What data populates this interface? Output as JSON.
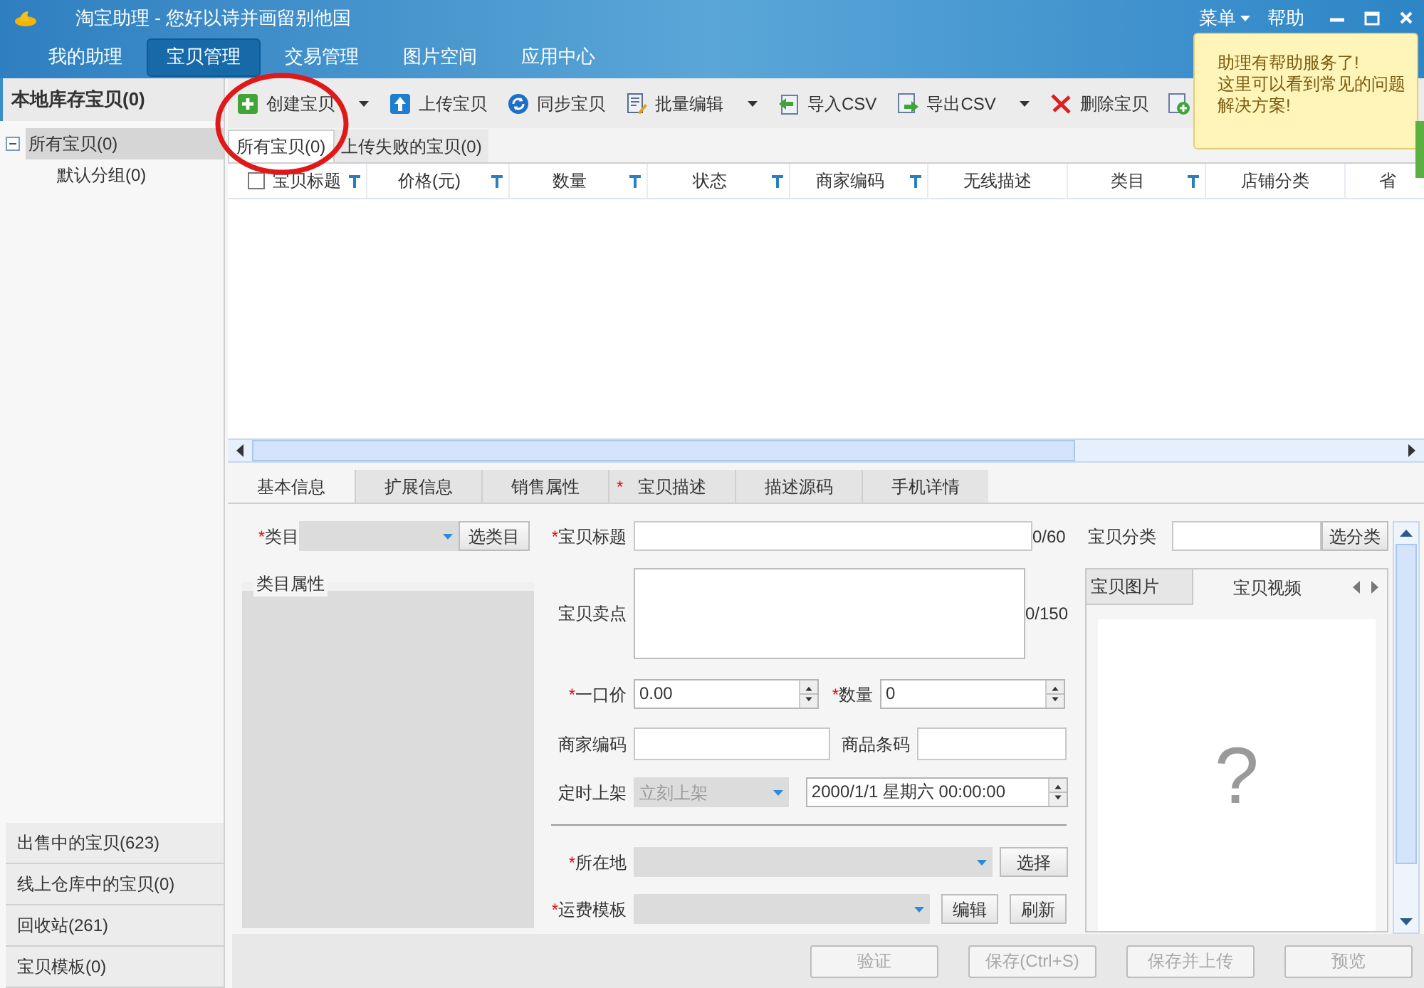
{
  "window": {
    "title": "淘宝助理 - 您好以诗并画留别他国",
    "menu": "菜单",
    "help": "帮助"
  },
  "nav_tabs": [
    {
      "label": "我的助理",
      "selected": false
    },
    {
      "label": "宝贝管理",
      "selected": true
    },
    {
      "label": "交易管理",
      "selected": false
    },
    {
      "label": "图片空间",
      "selected": false
    },
    {
      "label": "应用中心",
      "selected": false
    }
  ],
  "help_tooltip": {
    "lines": [
      "助理有帮助服务了!",
      "这里可以看到常见的问题",
      "解决方案!"
    ]
  },
  "sidebar": {
    "header": "本地库存宝贝(0)",
    "tree": [
      {
        "label": "所有宝贝(0)",
        "selected": true,
        "expanded": true,
        "children": [
          {
            "label": "默认分组(0)",
            "selected": false
          }
        ]
      }
    ],
    "bottom_items": [
      "出售中的宝贝(623)",
      "线上仓库中的宝贝(0)",
      "回收站(261)",
      "宝贝模板(0)"
    ]
  },
  "toolbar": [
    {
      "kind": "add",
      "label": "创建宝贝",
      "dropdown": true
    },
    {
      "kind": "upload",
      "label": "上传宝贝",
      "dropdown": false
    },
    {
      "kind": "sync",
      "label": "同步宝贝",
      "dropdown": false
    },
    {
      "kind": "edit",
      "label": "批量编辑",
      "dropdown": true
    },
    {
      "kind": "import",
      "label": "导入CSV",
      "dropdown": false
    },
    {
      "kind": "export",
      "label": "导出CSV",
      "dropdown": true
    },
    {
      "kind": "delete",
      "label": "删除宝贝",
      "dropdown": false
    },
    {
      "kind": "add-doc",
      "dropdown": false
    }
  ],
  "list_tabs": [
    {
      "label": "所有宝贝(0)",
      "selected": true
    },
    {
      "label": "上传失败的宝贝(0)",
      "selected": false
    }
  ],
  "required_mark": "*",
  "table": {
    "select_all": {
      "checked": false
    },
    "columns": [
      {
        "label": "宝贝标题",
        "filter": true
      },
      {
        "label": "价格(元)",
        "filter": true
      },
      {
        "label": "数量",
        "filter": true
      },
      {
        "label": "状态",
        "filter": true
      },
      {
        "label": "商家编码",
        "filter": true
      },
      {
        "label": "无线描述",
        "filter": false
      },
      {
        "label": "类目",
        "filter": true
      },
      {
        "label": "店铺分类",
        "filter": false
      },
      {
        "label": "省",
        "filter": false
      }
    ]
  },
  "detail_tabs": [
    {
      "label": "基本信息",
      "selected": true,
      "required": false
    },
    {
      "label": "扩展信息",
      "selected": false,
      "required": false
    },
    {
      "label": "销售属性",
      "selected": false,
      "required": false
    },
    {
      "label": "宝贝描述",
      "selected": false,
      "required": true
    },
    {
      "label": "描述源码",
      "selected": false,
      "required": false
    },
    {
      "label": "手机详情",
      "selected": false,
      "required": false
    }
  ],
  "form": {
    "category": {
      "label": "类目",
      "required": true,
      "button": "选类目"
    },
    "category_attributes": {
      "label": "类目属性"
    },
    "title": {
      "label": "宝贝标题",
      "required": true,
      "counter": "0/60"
    },
    "selling_points": {
      "label": "宝贝卖点",
      "required": false,
      "counter": "0/150"
    },
    "price": {
      "label": "一口价",
      "required": true,
      "value": "0.00"
    },
    "quantity": {
      "label": "数量",
      "required": true,
      "value": "0"
    },
    "merchant_code": {
      "label": "商家编码",
      "required": false
    },
    "barcode": {
      "label": "商品条码",
      "required": false
    },
    "schedule": {
      "label": "定时上架",
      "required": false,
      "value": "立刻上架",
      "disabled": true,
      "datetime": "2000/1/1 星期六 00:00:00"
    },
    "location": {
      "label": "所在地",
      "required": true,
      "button": "选择"
    },
    "shipping": {
      "label": "运费模板",
      "required": true,
      "buttons": [
        "编辑",
        "刷新"
      ]
    },
    "shop_category": {
      "label": "宝贝分类",
      "required": false,
      "button": "选分类"
    },
    "media_tabs": [
      {
        "label": "宝贝图片",
        "selected": false
      },
      {
        "label": "宝贝视频",
        "selected": true
      }
    ],
    "media_placeholder": "?"
  },
  "actions": [
    {
      "label": "验证",
      "disabled": true
    },
    {
      "label": "保存(Ctrl+S)",
      "disabled": true
    },
    {
      "label": "保存并上传",
      "disabled": true
    },
    {
      "label": "预览",
      "disabled": true
    }
  ]
}
